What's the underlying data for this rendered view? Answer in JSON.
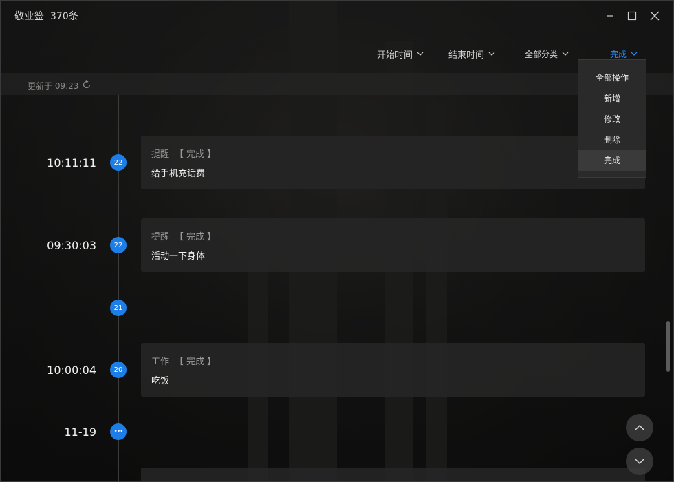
{
  "app": {
    "title": "敬业签",
    "count": "370条"
  },
  "filters": {
    "start_time": "开始时间",
    "end_time": "结束时间",
    "category": "全部分类",
    "status": "完成"
  },
  "update": {
    "text": "更新于 09:23"
  },
  "dropdown": {
    "items": [
      "全部操作",
      "新增",
      "修改",
      "删除",
      "完成"
    ],
    "selected": "完成"
  },
  "timeline": {
    "entries": [
      {
        "time": "10:11:11",
        "day": "22",
        "category": "提醒",
        "status": "完成",
        "content": "给手机充话费"
      },
      {
        "time": "09:30:03",
        "day": "22",
        "category": "提醒",
        "status": "完成",
        "content": "活动一下身体"
      },
      {
        "day": "21"
      },
      {
        "time": "10:00:04",
        "day": "20",
        "category": "工作",
        "status": "完成",
        "content": "吃饭"
      },
      {
        "time": "11-19",
        "day": "•••"
      }
    ]
  },
  "colors": {
    "accent": "#2f8cff",
    "dot": "#1e7ee8",
    "card": "#262626",
    "background": "#141414"
  }
}
